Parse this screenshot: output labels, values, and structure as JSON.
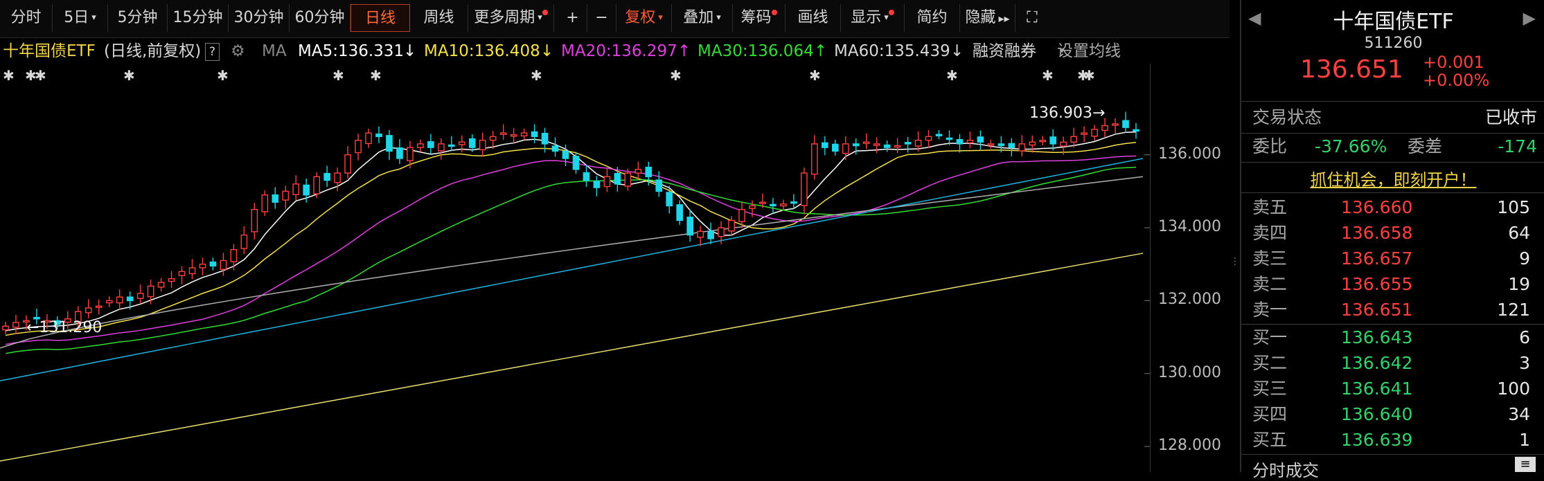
{
  "toolbar": {
    "items": [
      {
        "label": "分时",
        "caret": false,
        "dot": false,
        "active": false
      },
      {
        "label": "5日",
        "caret": true,
        "dot": false,
        "active": false
      },
      {
        "label": "5分钟",
        "caret": false,
        "dot": false,
        "active": false
      },
      {
        "label": "15分钟",
        "caret": false,
        "dot": false,
        "active": false
      },
      {
        "label": "30分钟",
        "caret": false,
        "dot": false,
        "active": false
      },
      {
        "label": "60分钟",
        "caret": false,
        "dot": false,
        "active": false
      },
      {
        "label": "日线",
        "caret": false,
        "dot": false,
        "active": true
      },
      {
        "label": "周线",
        "caret": false,
        "dot": false,
        "active": false
      },
      {
        "label": "更多周期",
        "caret": true,
        "dot": true,
        "active": false
      },
      {
        "label": "+",
        "caret": false,
        "dot": false,
        "active": false
      },
      {
        "label": "−",
        "caret": false,
        "dot": false,
        "active": false
      },
      {
        "label": "复权",
        "caret": true,
        "dot": false,
        "active": false,
        "red": true
      },
      {
        "label": "叠加",
        "caret": true,
        "dot": false,
        "active": false
      },
      {
        "label": "筹码",
        "caret": false,
        "dot": true,
        "active": false
      },
      {
        "label": "画线",
        "caret": false,
        "dot": false,
        "active": false
      },
      {
        "label": "显示",
        "caret": true,
        "dot": true,
        "active": false
      },
      {
        "label": "简约",
        "caret": false,
        "dot": false,
        "active": false
      },
      {
        "label": "隐藏",
        "caret": false,
        "dot": false,
        "active": false,
        "suffix": "▸▸"
      }
    ]
  },
  "legend": {
    "name": "十年国债ETF",
    "mode": "(日线,前复权)",
    "help": "?",
    "ma_label": "MA",
    "ma5": "MA5:136.331",
    "ma5_arrow": "↓",
    "ma10": "MA10:136.408",
    "ma10_arrow": "↓",
    "ma20": "MA20:136.297",
    "ma20_arrow": "↑",
    "ma30": "MA30:136.064",
    "ma30_arrow": "↑",
    "ma60": "MA60:135.439",
    "ma60_arrow": "↓",
    "margin": "融资融券",
    "settings": "设置均线"
  },
  "colors": {
    "up": "#ff4040",
    "down": "#1fd6e8",
    "ma5": "#ffffff",
    "ma10": "#f5e24a",
    "ma20": "#e040e0",
    "ma30": "#33dd33",
    "ma60": "#b0b0b0",
    "ma120": "#1fb4e0",
    "ma250": "#e8e070"
  },
  "chart_data": {
    "type": "candlestick",
    "title": "",
    "xlabel": "",
    "ylabel": "",
    "ylim": [
      127.3,
      138.5
    ],
    "yticks": [
      "136.000",
      "134.000",
      "132.000",
      "130.000",
      "128.000"
    ],
    "ytick_values": [
      136,
      134,
      132,
      130,
      128
    ],
    "annotations": [
      {
        "text": "131.290",
        "value": 131.29
      },
      {
        "text": "136.903",
        "value": 136.903
      }
    ],
    "closes": [
      131.3,
      131.4,
      131.45,
      131.5,
      131.45,
      131.35,
      131.5,
      131.7,
      131.8,
      131.85,
      132.0,
      132.1,
      132.0,
      132.2,
      132.4,
      132.5,
      132.6,
      132.8,
      132.9,
      133.0,
      132.95,
      133.1,
      133.4,
      133.8,
      134.5,
      134.9,
      134.7,
      135.0,
      135.2,
      134.9,
      135.4,
      135.3,
      135.5,
      136.0,
      136.4,
      136.6,
      136.5,
      136.1,
      135.9,
      136.2,
      136.3,
      136.2,
      136.3,
      136.25,
      136.35,
      136.2,
      136.4,
      136.5,
      136.6,
      136.55,
      136.6,
      136.5,
      136.3,
      136.1,
      135.9,
      135.6,
      135.3,
      135.1,
      135.4,
      135.2,
      135.5,
      135.6,
      135.4,
      135.0,
      134.6,
      134.2,
      133.8,
      133.9,
      133.7,
      134.0,
      134.2,
      134.5,
      134.6,
      134.7,
      134.6,
      134.65,
      134.7,
      135.5,
      136.3,
      136.2,
      136.1,
      136.3,
      136.25,
      136.35,
      136.3,
      136.2,
      136.25,
      136.3,
      136.4,
      136.5,
      136.55,
      136.45,
      136.3,
      136.4,
      136.35,
      136.3,
      136.25,
      136.2,
      136.3,
      136.35,
      136.4,
      136.3,
      136.35,
      136.5,
      136.6,
      136.7,
      136.8,
      136.85,
      136.75,
      136.65
    ],
    "ma": [
      {
        "name": "MA5",
        "last": 136.331
      },
      {
        "name": "MA10",
        "last": 136.408
      },
      {
        "name": "MA20",
        "last": 136.297
      },
      {
        "name": "MA30",
        "last": 136.064
      },
      {
        "name": "MA60",
        "last": 135.439
      }
    ]
  },
  "right_panel": {
    "name": "十年国债ETF",
    "code": "511260",
    "price": "136.651",
    "change": "+0.001",
    "change_pct": "+0.00%",
    "status_label": "交易状态",
    "status_value": "已收市",
    "wb_label": "委比",
    "wb_value": "-37.66%",
    "wc_label": "委差",
    "wc_value": "-174",
    "promo": "抓住机会，即刻开户！",
    "asks": [
      {
        "label": "卖五",
        "price": "136.660",
        "vol": "105"
      },
      {
        "label": "卖四",
        "price": "136.658",
        "vol": "64"
      },
      {
        "label": "卖三",
        "price": "136.657",
        "vol": "9"
      },
      {
        "label": "卖二",
        "price": "136.655",
        "vol": "19"
      },
      {
        "label": "卖一",
        "price": "136.651",
        "vol": "121"
      }
    ],
    "bids": [
      {
        "label": "买一",
        "price": "136.643",
        "vol": "6"
      },
      {
        "label": "买二",
        "price": "136.642",
        "vol": "3"
      },
      {
        "label": "买三",
        "price": "136.641",
        "vol": "100"
      },
      {
        "label": "买四",
        "price": "136.640",
        "vol": "34"
      },
      {
        "label": "买五",
        "price": "136.639",
        "vol": "1"
      }
    ],
    "bottom_label": "分时成交"
  }
}
